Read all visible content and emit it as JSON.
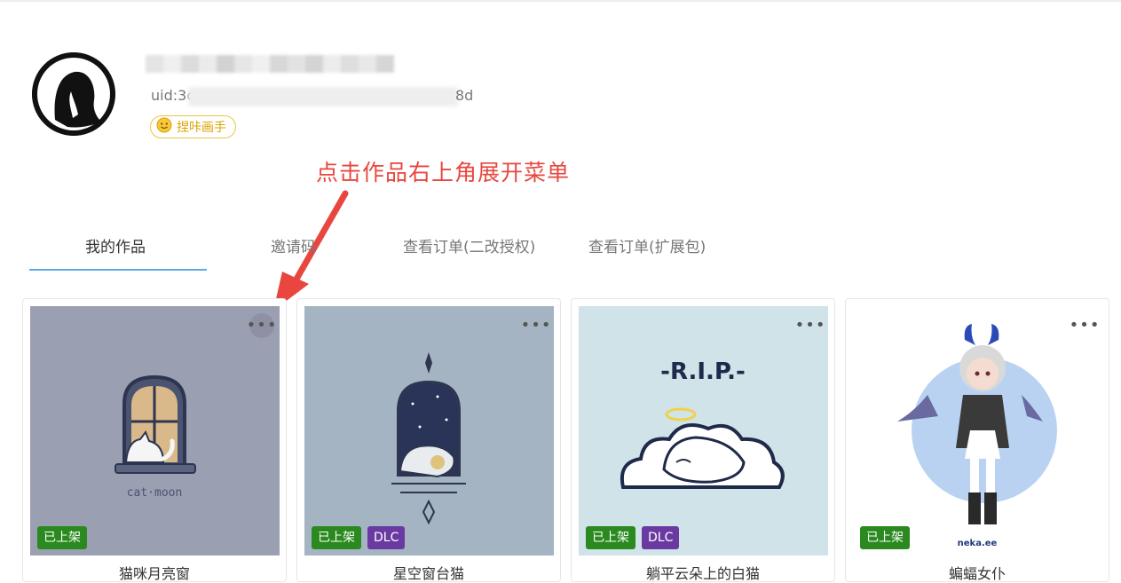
{
  "profile": {
    "uid_prefix": "uid:3c",
    "uid_suffix": "8d",
    "badge_label": "捏咔画手"
  },
  "annotation": {
    "text": "点击作品右上角展开菜单"
  },
  "tabs": [
    {
      "label": "我的作品",
      "active": true
    },
    {
      "label": "邀请码",
      "active": false
    },
    {
      "label": "查看订单(二改授权)",
      "active": false
    },
    {
      "label": "查看订单(扩展包)",
      "active": false
    }
  ],
  "works": [
    {
      "title": "猫咪月亮窗",
      "thumb_bg": "#9a9fb1",
      "tags": [
        "已上架"
      ],
      "more": "•••"
    },
    {
      "title": "星空窗台猫",
      "thumb_bg": "#a5b4c2",
      "tags": [
        "已上架",
        "DLC"
      ],
      "more": "•••"
    },
    {
      "title": "躺平云朵上的白猫",
      "thumb_bg": "#cfe3e8",
      "tags": [
        "已上架",
        "DLC"
      ],
      "more": "•••"
    },
    {
      "title": "蝙蝠女仆",
      "thumb_bg": "#ffffff",
      "tags": [
        "已上架"
      ],
      "more": "•••"
    }
  ],
  "colors": {
    "annotation": "#e8463f",
    "tab_underline": "#5ea8e6",
    "tag_listed": "#2a8a1f",
    "tag_dlc": "#6a3aa2",
    "badge": "#e8c547"
  }
}
